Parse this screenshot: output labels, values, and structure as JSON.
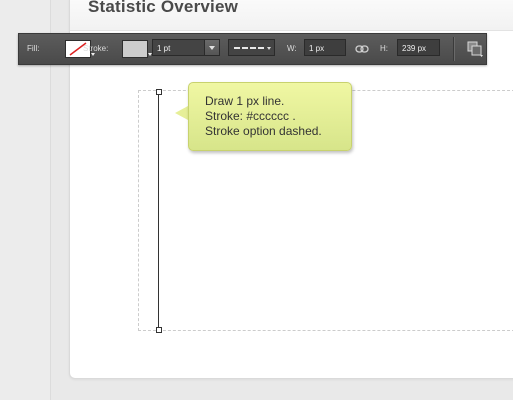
{
  "page": {
    "title": "Statistic Overview"
  },
  "toolbar": {
    "fill_label": "Fill:",
    "stroke_label": "Stroke:",
    "stroke_width": "1 pt",
    "stroke_style": "dashed",
    "width_label": "W:",
    "width_value": "1 px",
    "height_label": "H:",
    "height_value": "239 px",
    "fill_color": "none",
    "stroke_color": "#cccccc",
    "icons": [
      "fill-none-swatch",
      "dropdown-caret",
      "dash-style",
      "link-icon",
      "arrange-icon"
    ]
  },
  "tooltip": {
    "lines": [
      "Draw 1 px line.",
      "Stroke: #cccccc .",
      "Stroke option dashed."
    ],
    "background": "#e6ef98"
  },
  "canvas": {
    "border_color": "#cccccc",
    "line_color": "#333333"
  }
}
